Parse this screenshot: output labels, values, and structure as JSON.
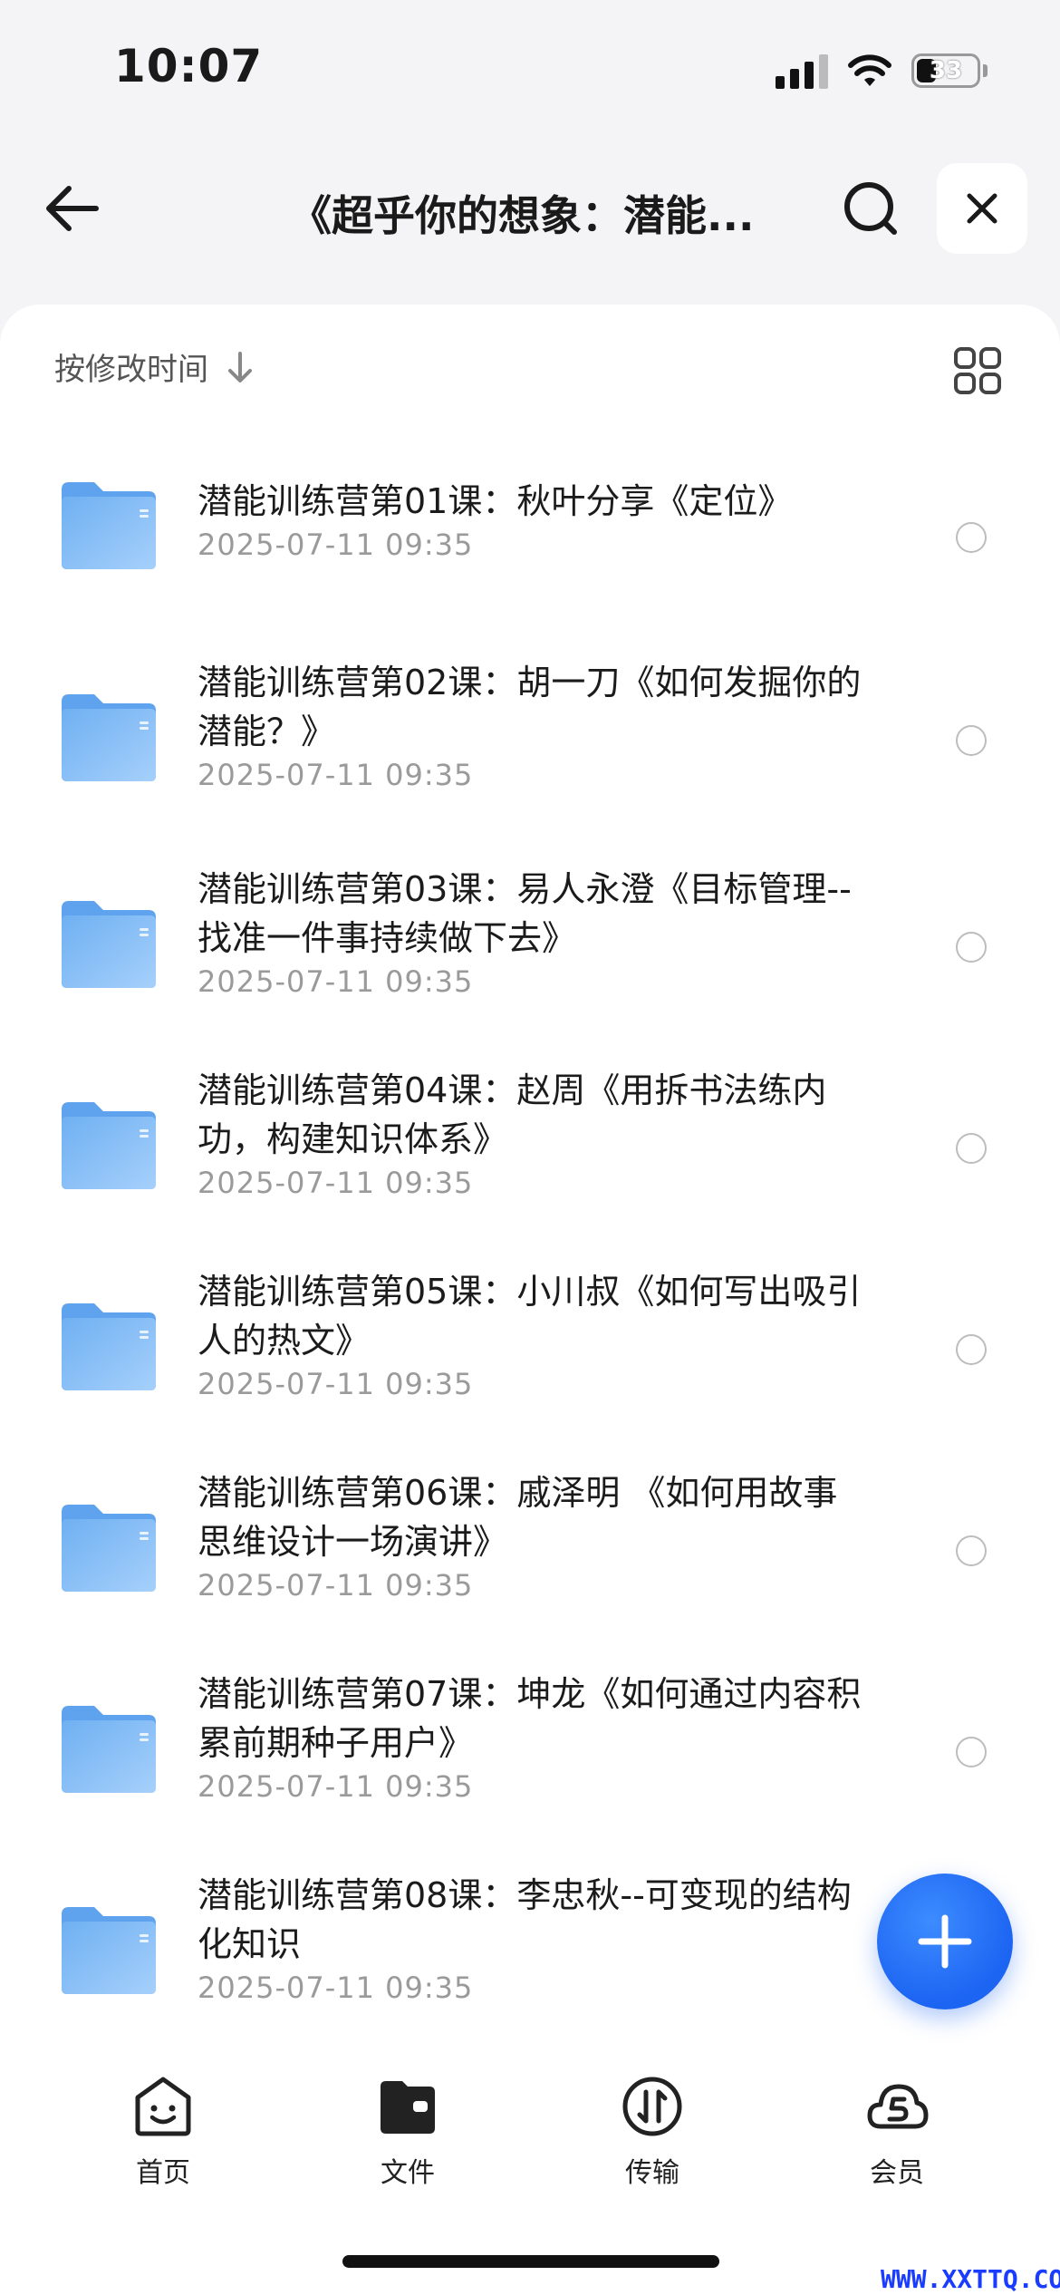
{
  "status_bar": {
    "time": "10:07",
    "battery": "33"
  },
  "header": {
    "title": "《超乎你的想象：潜能...",
    "back_icon": "arrow-left-icon",
    "search_icon": "search-icon",
    "close_icon": "close-icon"
  },
  "sort": {
    "label": "按修改时间",
    "direction_icon": "arrow-down-icon",
    "view_icon": "grid-view-icon"
  },
  "files": [
    {
      "name": "潜能训练营第01课：秋叶分享《定位》",
      "date": "2025-07-11 09:35"
    },
    {
      "name": "潜能训练营第02课：胡一刀《如何发掘你的潜能？》",
      "date": "2025-07-11 09:35"
    },
    {
      "name": "潜能训练营第03课：易人永澄《目标管理--找准一件事持续做下去》",
      "date": "2025-07-11 09:35"
    },
    {
      "name": "潜能训练营第04课：赵周《用拆书法练内功，构建知识体系》",
      "date": "2025-07-11 09:35"
    },
    {
      "name": "潜能训练营第05课：小川叔《如何写出吸引人的热文》",
      "date": "2025-07-11 09:35"
    },
    {
      "name": "潜能训练营第06课：戚泽明 《如何用故事思维设计一场演讲》",
      "date": "2025-07-11 09:35"
    },
    {
      "name": "潜能训练营第07课：坤龙《如何通过内容积累前期种子用户》",
      "date": "2025-07-11 09:35"
    },
    {
      "name": "潜能训练营第08课：李忠秋--可变现的结构化知识",
      "date": "2025-07-11 09:35"
    }
  ],
  "fab_icon": "plus-icon",
  "tabs": [
    {
      "label": "首页",
      "icon": "home-face-icon"
    },
    {
      "label": "文件",
      "icon": "folder-wallet-icon"
    },
    {
      "label": "传输",
      "icon": "transfer-icon"
    },
    {
      "label": "会员",
      "icon": "cloud-vip-icon"
    }
  ],
  "watermark": "WWW.XXTTQ.COM",
  "colors": {
    "accent": "#1c64f2",
    "folder": "#7fb8f3",
    "date_text": "#9a9a9a"
  }
}
